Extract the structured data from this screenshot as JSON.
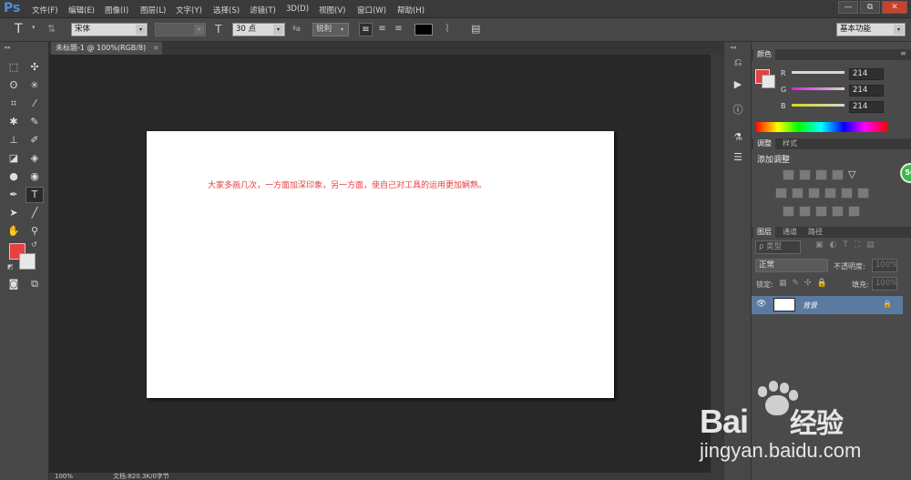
{
  "app": {
    "logo": "Ps"
  },
  "menu": {
    "items": [
      "文件(F)",
      "编辑(E)",
      "图像(I)",
      "图层(L)",
      "文字(Y)",
      "选择(S)",
      "滤镜(T)",
      "3D(D)",
      "视图(V)",
      "窗口(W)",
      "帮助(H)"
    ]
  },
  "window": {
    "minimize": "—",
    "restore": "⧉",
    "close": "✕"
  },
  "options": {
    "tool_glyph": "T",
    "font_family": "宋体",
    "font_style": "-",
    "size_glyph": "T",
    "font_size": "30 点",
    "aa_glyph": "ªa",
    "anti_alias": "锐利",
    "workspace": "基本功能"
  },
  "document": {
    "tab_title": "未标题-1 @ 100%(RGB/8)",
    "tab_close": "×",
    "text": "大家多画几次，一方面加深印象，另一方面，使自己对工具的运用更加娴熟。"
  },
  "status": {
    "zoom": "100%",
    "info": "文档:820.3K/0字节"
  },
  "colors": {
    "foreground": "#e64040",
    "background": "#e8e8e8"
  },
  "panels": {
    "color": {
      "tab": "颜色",
      "channels": [
        {
          "label": "R",
          "value": "214"
        },
        {
          "label": "G",
          "value": "214"
        },
        {
          "label": "B",
          "value": "214"
        }
      ]
    },
    "adjust": {
      "tabs": [
        "调整",
        "样式"
      ],
      "title": "添加调整"
    },
    "layers": {
      "tabs": [
        "图层",
        "通道",
        "路径"
      ],
      "filter_kind": "ρ 类型",
      "blend_mode": "正常",
      "opacity_label": "不透明度:",
      "opacity_value": "100%",
      "lock_label": "锁定:",
      "fill_label": "填充:",
      "fill_value": "100%",
      "layer_name": "背景"
    }
  },
  "badge": {
    "text": "50"
  },
  "watermark": {
    "brand": "Bai",
    "brand_suffix": "经验",
    "url": "jingyan.baidu.com"
  }
}
